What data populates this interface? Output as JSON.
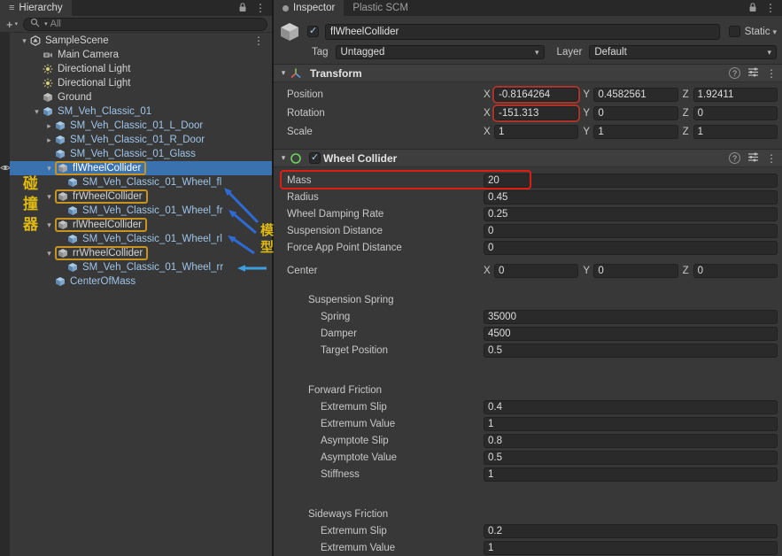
{
  "hierarchy": {
    "tab": "Hierarchy",
    "search_placeholder": "All",
    "annotation_left": "碰撞器",
    "annotation_right": "模型",
    "annotation_colors": {
      "text": "#dfb90f",
      "arrow": "#2e6bd4",
      "arrow_alt": "#3e9ddd",
      "outline": "#c8941f",
      "red_box": "#e01d13"
    },
    "rows": [
      {
        "label": "SampleScene",
        "level": 0,
        "icon": "unity-scene",
        "arrow": "down",
        "kebab": true
      },
      {
        "label": "Main Camera",
        "level": 1,
        "icon": "camera"
      },
      {
        "label": "Directional Light",
        "level": 1,
        "icon": "light"
      },
      {
        "label": "Directional Light",
        "level": 1,
        "icon": "light"
      },
      {
        "label": "Ground",
        "level": 1,
        "icon": "cube-gray"
      },
      {
        "label": "SM_Veh_Classic_01",
        "level": 1,
        "icon": "cube-prefab",
        "arrow": "down",
        "prefab": true
      },
      {
        "label": "SM_Veh_Classic_01_L_Door",
        "level": 2,
        "icon": "cube-prefab",
        "arrow": "right",
        "prefab": true
      },
      {
        "label": "SM_Veh_Classic_01_R_Door",
        "level": 2,
        "icon": "cube-prefab",
        "arrow": "right",
        "prefab": true
      },
      {
        "label": "SM_Veh_Classic_01_Glass",
        "level": 2,
        "icon": "cube-prefab",
        "prefab": true
      },
      {
        "label": "flWheelCollider",
        "level": 2,
        "icon": "cube-gray",
        "arrow": "down",
        "selected": true,
        "outlined": true
      },
      {
        "label": "SM_Veh_Classic_01_Wheel_fl",
        "level": 3,
        "icon": "cube-prefab",
        "prefab": true
      },
      {
        "label": "frWheelCollider",
        "level": 2,
        "icon": "cube-gray",
        "arrow": "down",
        "outlined": true
      },
      {
        "label": "SM_Veh_Classic_01_Wheel_fr",
        "level": 3,
        "icon": "cube-prefab",
        "prefab": true
      },
      {
        "label": "rlWheelCollider",
        "level": 2,
        "icon": "cube-gray",
        "arrow": "down",
        "outlined": true
      },
      {
        "label": "SM_Veh_Classic_01_Wheel_rl",
        "level": 3,
        "icon": "cube-prefab",
        "prefab": true
      },
      {
        "label": "rrWheelCollider",
        "level": 2,
        "icon": "cube-gray",
        "arrow": "down",
        "outlined": true
      },
      {
        "label": "SM_Veh_Classic_01_Wheel_rr",
        "level": 3,
        "icon": "cube-prefab",
        "prefab": true
      },
      {
        "label": "CenterOfMass",
        "level": 2,
        "icon": "cube-prefab",
        "prefab": true
      }
    ]
  },
  "inspector": {
    "tabs": [
      "Inspector",
      "Plastic SCM"
    ],
    "gameobject": {
      "name": "flWheelCollider",
      "static_label": "Static",
      "tag_label": "Tag",
      "tag_value": "Untagged",
      "layer_label": "Layer",
      "layer_value": "Default"
    },
    "transform": {
      "title": "Transform",
      "axis_labels": [
        "X",
        "Y",
        "Z"
      ],
      "rows": [
        {
          "label": "Position",
          "x": "-0.8164264",
          "y": "0.4582561",
          "z": "1.92411",
          "x_highlight": true
        },
        {
          "label": "Rotation",
          "x": "-151.313",
          "y": "0",
          "z": "0",
          "x_highlight": true
        },
        {
          "label": "Scale",
          "x": "1",
          "y": "1",
          "z": "1"
        }
      ]
    },
    "wheel_collider": {
      "title": "Wheel Collider",
      "fields": [
        {
          "label": "Mass",
          "value": "20",
          "highlight": true
        },
        {
          "label": "Radius",
          "value": "0.45"
        },
        {
          "label": "Wheel Damping Rate",
          "value": "0.25"
        },
        {
          "label": "Suspension Distance",
          "value": "0"
        },
        {
          "label": "Force App Point Distance",
          "value": "0"
        },
        {
          "label": "Center",
          "type": "vector",
          "x": "0",
          "y": "0",
          "z": "0",
          "gap_before": true
        },
        {
          "type": "spacer",
          "size": "s1"
        },
        {
          "label": "Suspension Spring",
          "type": "group"
        },
        {
          "label": "Spring",
          "value": "35000",
          "indent": true
        },
        {
          "label": "Damper",
          "value": "4500",
          "indent": true
        },
        {
          "label": "Target Position",
          "value": "0.5",
          "indent": true
        },
        {
          "type": "spacer",
          "size": "s2"
        },
        {
          "label": "Forward Friction",
          "type": "group"
        },
        {
          "label": "Extremum Slip",
          "value": "0.4",
          "indent": true
        },
        {
          "label": "Extremum Value",
          "value": "1",
          "indent": true
        },
        {
          "label": "Asymptote Slip",
          "value": "0.8",
          "indent": true
        },
        {
          "label": "Asymptote Value",
          "value": "0.5",
          "indent": true
        },
        {
          "label": "Stiffness",
          "value": "1",
          "indent": true
        },
        {
          "type": "spacer",
          "size": "s2"
        },
        {
          "label": "Sideways Friction",
          "type": "group"
        },
        {
          "label": "Extremum Slip",
          "value": "0.2",
          "indent": true
        },
        {
          "label": "Extremum Value",
          "value": "1",
          "indent": true
        }
      ]
    }
  }
}
